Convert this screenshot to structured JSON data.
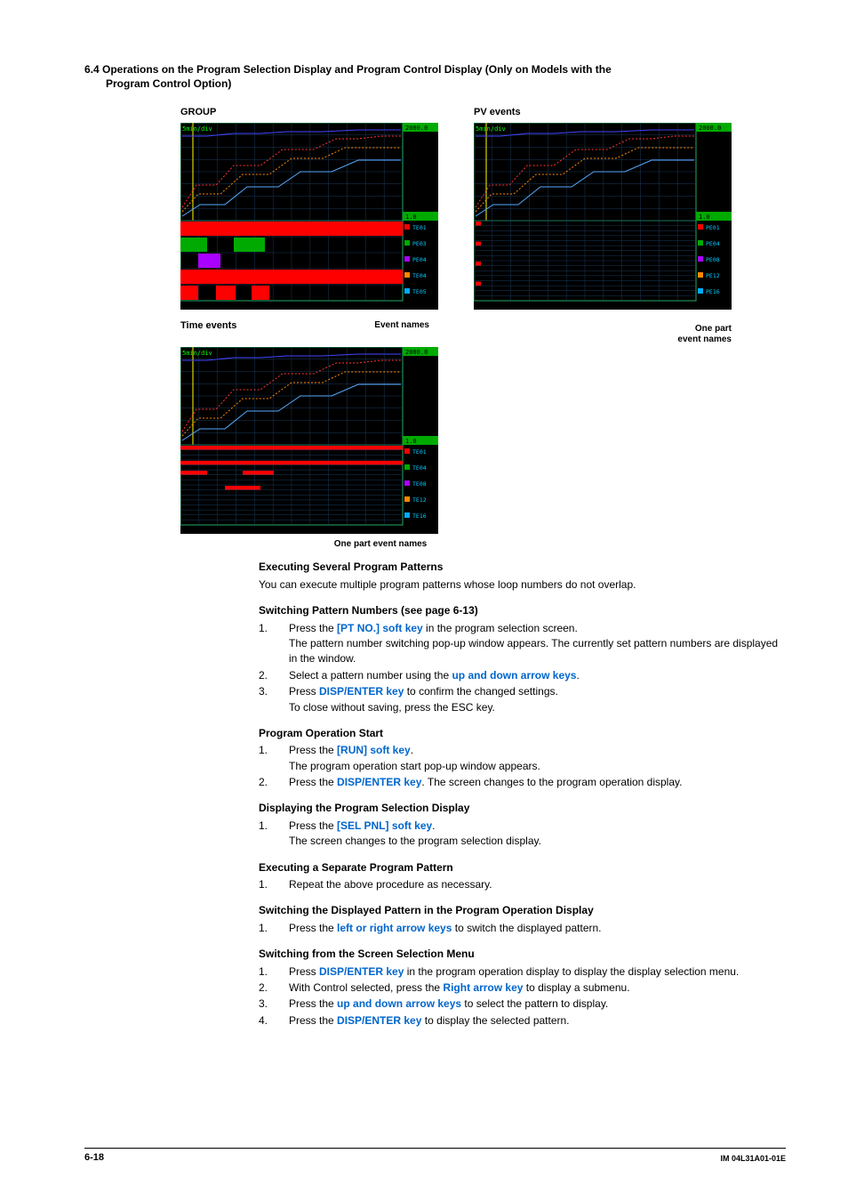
{
  "header": {
    "line1": "6.4  Operations on the Program Selection Display and Program Control Display (Only on Models with the",
    "line2": "Program Control Option)"
  },
  "screens": {
    "group": {
      "title": "GROUP",
      "timebase": "5min/div",
      "ymax": "2000.0",
      "ymin": "1.0",
      "events": [
        "TE01",
        "PE03",
        "PE04",
        "TE04",
        "TE05"
      ]
    },
    "pv": {
      "title": "PV events",
      "timebase": "5min/div",
      "ymax": "2000.0",
      "ymin": "1.0",
      "events": [
        "PE01",
        "PE04",
        "PE08",
        "PE12",
        "PE16"
      ]
    },
    "time": {
      "title": "Time events",
      "timebase": "5min/div",
      "ymax": "2000.0",
      "ymin": "1.0",
      "events": [
        "TE01",
        "TE04",
        "TE08",
        "TE12",
        "TE16"
      ]
    },
    "label_event_names": "Event names",
    "label_one_part_event_names": "One part event names",
    "label_one_part_event_names_2": "One part\nevent names"
  },
  "body": {
    "exec_several_h": "Executing Several Program Patterns",
    "exec_several_p": "You can execute multiple program patterns whose loop numbers do not overlap.",
    "switch_h": "Switching Pattern Numbers (see page 6-13)",
    "switch_1a": "Press the ",
    "switch_1b": "[PT NO.] soft key",
    "switch_1c": " in the program selection screen.",
    "switch_1d": "The pattern number switching pop-up window appears.  The currently set pattern numbers are displayed in the window.",
    "switch_2a": "Select a pattern number using the ",
    "switch_2b": "up and down arrow keys",
    "switch_2c": ".",
    "switch_3a": "Press ",
    "switch_3b": "DISP/ENTER key",
    "switch_3c": " to confirm the changed settings.",
    "switch_3d": "To close without saving, press the ESC key.",
    "progstart_h": "Program Operation Start",
    "progstart_1a": "Press the ",
    "progstart_1b": "[RUN] soft key",
    "progstart_1c": ".",
    "progstart_1d": "The program operation start pop-up window appears.",
    "progstart_2a": "Press the ",
    "progstart_2b": "DISP/ENTER key",
    "progstart_2c": ".  The screen changes to the program operation display.",
    "dispsel_h": "Displaying the Program Selection Display",
    "dispsel_1a": "Press the ",
    "dispsel_1b": "[SEL PNL] soft key",
    "dispsel_1c": ".",
    "dispsel_1d": "The screen changes to the program selection display.",
    "execsep_h": "Executing a Separate Program Pattern",
    "execsep_1": "Repeat the above procedure as necessary.",
    "swdisp_h": "Switching the Displayed Pattern in the Program Operation Display",
    "swdisp_1a": "Press the ",
    "swdisp_1b": "left or right arrow keys",
    "swdisp_1c": " to switch the displayed pattern.",
    "swmenu_h": "Switching from the Screen Selection Menu",
    "swmenu_1a": "Press ",
    "swmenu_1b": "DISP/ENTER key",
    "swmenu_1c": " in the program operation display to display the display selection menu.",
    "swmenu_2a": "With Control selected, press the ",
    "swmenu_2b": "Right arrow key",
    "swmenu_2c": " to display a submenu.",
    "swmenu_3a": "Press the ",
    "swmenu_3b": "up and down arrow keys",
    "swmenu_3c": " to select the pattern to display.",
    "swmenu_4a": "Press the ",
    "swmenu_4b": "DISP/ENTER key",
    "swmenu_4c": " to display the selected pattern."
  },
  "footer": {
    "page": "6-18",
    "doc": "IM 04L31A01-01E"
  }
}
